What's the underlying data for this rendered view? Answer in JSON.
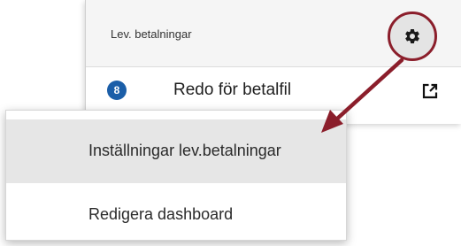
{
  "widget": {
    "title": "Lev. betalningar",
    "settings_icon": "gear-icon",
    "row": {
      "count": "8",
      "label": "Redo för betalfil",
      "action_icon": "open-external-icon"
    }
  },
  "menu": {
    "items": [
      {
        "label": "Inställningar lev.betalningar",
        "highlighted": true
      },
      {
        "label": "Redigera dashboard",
        "highlighted": false
      }
    ]
  },
  "colors": {
    "annotation": "#8b1e2b",
    "badge": "#1b5ea8",
    "header_bg": "#f5f5f5",
    "menu_highlight": "#e6e6e6"
  }
}
